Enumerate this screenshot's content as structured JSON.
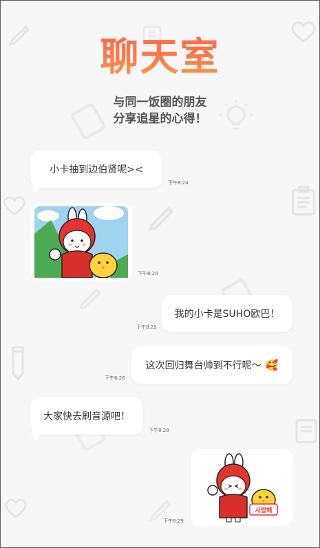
{
  "header": {
    "title": "聊天室",
    "subtitle_line1": "与同一饭圈的朋友",
    "subtitle_line2": "分享追星的心得！"
  },
  "messages": [
    {
      "side": "left",
      "type": "text",
      "text": "小卡抽到边伯贤呢><",
      "time": "下午8:24"
    },
    {
      "side": "left",
      "type": "sticker",
      "sticker": "rabbit-and-chick-sticker",
      "time": "下午8:24"
    },
    {
      "side": "right",
      "type": "text",
      "text": "我的小卡是SUHO欧巴！",
      "time": "下午8:25"
    },
    {
      "side": "right",
      "type": "text",
      "text": "这次回归舞台帅到不行呢～",
      "emoji": "🥰",
      "time": "下午8:26"
    },
    {
      "side": "left",
      "type": "text",
      "text": "大家快去刷音源吧！",
      "time": "下午8:28"
    },
    {
      "side": "right",
      "type": "sticker",
      "sticker": "rabbit-and-chick-sign-sticker",
      "sign_text": "사랑해",
      "time": "下午8:29"
    }
  ],
  "colors": {
    "title_start": "#ff6a4a",
    "title_end": "#ffa24a",
    "background": "#f7f7f7"
  }
}
